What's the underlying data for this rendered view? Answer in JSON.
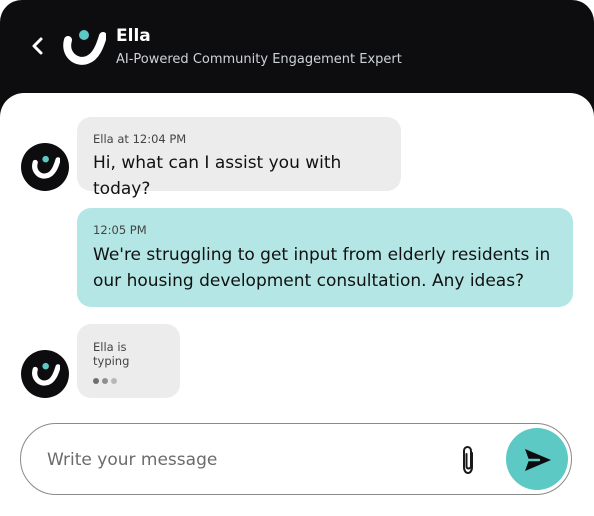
{
  "colors": {
    "header_bg": "#0d0d10",
    "accent": "#5cc9c4",
    "user_bubble": "#b3e6e4",
    "bot_bubble": "#ececec"
  },
  "header": {
    "back_icon": "chevron-left-icon",
    "logo_icon": "ella-logo-icon",
    "name": "Ella",
    "subtitle": "AI-Powered Community Engagement Expert"
  },
  "messages": [
    {
      "sender": "bot",
      "meta": "Ella at 12:04 PM",
      "text": "Hi, what can I assist you with today?"
    },
    {
      "sender": "user",
      "meta": "12:05 PM",
      "line1": "We're struggling to get input from elderly residents in",
      "line2": "our housing development consultation. Any ideas?"
    }
  ],
  "typing": {
    "label": "Ella is typing",
    "dot_count": 3
  },
  "composer": {
    "placeholder": "Write your message",
    "value": "",
    "attach_icon": "paperclip-icon",
    "send_icon": "send-icon"
  }
}
